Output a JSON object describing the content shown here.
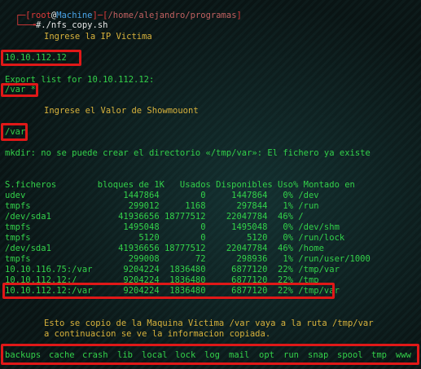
{
  "prompt": {
    "corner_top": "┌─[",
    "user": "root",
    "at": "@",
    "host": "Machine",
    "sep": "]─[",
    "path": "/home/alejandro/programas",
    "close": "]",
    "corner_bottom": "└──╼",
    "symbol": "#",
    "command": "./nfs_copy.sh"
  },
  "ask_ip": "Ingrese la IP Victima",
  "ip_input": "10.10.112.12",
  "export_list": "Export list for 10.10.112.12:",
  "export_entry": "/var *",
  "ask_mount": "Ingrese el Valor de Showmouont",
  "mount_input": "/var",
  "mkdir_error": "mkdir: no se puede crear el directorio «/tmp/var»: El fichero ya existe",
  "df_header": "S.ficheros        bloques de 1K   Usados Disponibles Uso% Montado en",
  "df_rows": [
    "udev                   1447864        0     1447864   0% /dev",
    "tmpfs                   299012     1168      297844   1% /run",
    "/dev/sda1             41936656 18777512    22047784  46% /",
    "tmpfs                  1495048        0     1495048   0% /dev/shm",
    "tmpfs                     5120        0        5120   0% /run/lock",
    "/dev/sda1             41936656 18777512    22047784  46% /home",
    "tmpfs                   299008       72      298936   1% /run/user/1000",
    "10.10.116.75:/var      9204224  1836480     6877120  22% /tmp/var",
    "10.10.112.12:/         9204224  1836480     6877120  22% /tmp",
    "10.10.112.12:/var      9204224  1836480     6877120  22% /tmp/var"
  ],
  "info_line1": "Esto se copio de la Maquina Victima /var vaya a la ruta /tmp/var",
  "info_line2": "a continuacion se ve la informacion copiada.",
  "dir_listing": [
    "backups",
    "cache",
    "crash",
    "lib",
    "local",
    "lock",
    "log",
    "mail",
    "opt",
    "run",
    "snap",
    "spool",
    "tmp",
    "www"
  ],
  "colors": {
    "background": "#0b1616",
    "text_green": "#33d14a",
    "text_yellow": "#d8b23c",
    "prompt_red": "#e03a3a",
    "host_blue": "#4aa3e8",
    "highlight_box": "#e01818"
  }
}
